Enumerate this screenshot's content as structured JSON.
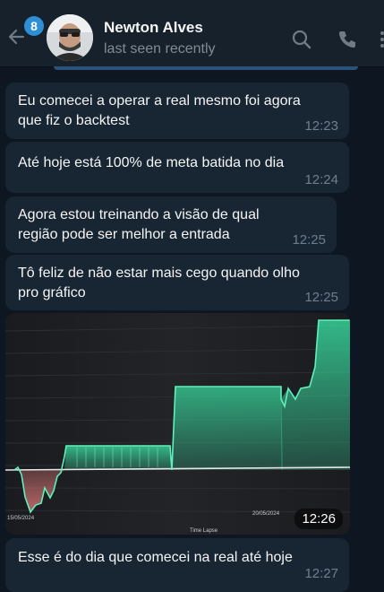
{
  "header": {
    "unread_count": "8",
    "contact_name": "Newton Alves",
    "status": "last seen recently",
    "icons": [
      "back-arrow-icon",
      "search-icon",
      "phone-icon",
      "more-vertical-icon"
    ]
  },
  "messages": [
    {
      "text": "Eu comecei a operar a real mesmo foi agora que fiz o backtest",
      "time": "12:23"
    },
    {
      "text": "Até hoje está 100% de meta batida no dia",
      "time": "12:24"
    },
    {
      "text": "Agora estou treinando a visão de qual região pode ser melhor a entrada",
      "time": "12:25"
    },
    {
      "text": "Tô feliz de não estar mais cego quando olho pro gráfico",
      "time": "12:25"
    },
    {
      "text": "Esse é do dia que comecei na real até hoje",
      "time": "12:27"
    }
  ],
  "image_message": {
    "time": "12:26",
    "labels": {
      "date_left": "15/05/2024",
      "date_right": "20/05/2024",
      "legend": "Time Lapse"
    }
  },
  "colors": {
    "background": "#0e1621",
    "header": "#17212b",
    "bubble": "#182533",
    "badge": "#2f8fd6",
    "equity_profit": "#37d39a",
    "equity_loss": "#e07a7a"
  }
}
